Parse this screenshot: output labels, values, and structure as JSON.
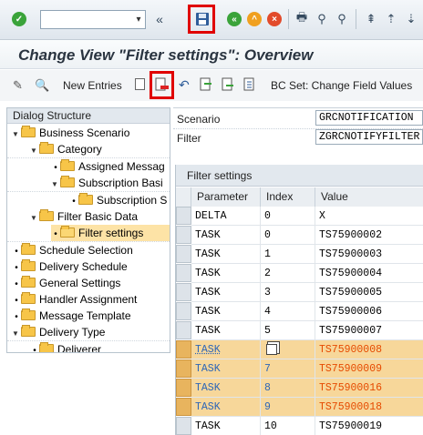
{
  "toolbar": {
    "command_value": "",
    "icons": [
      "enter-icon",
      "save-icon",
      "back-icon",
      "exit-icon",
      "cancel-icon",
      "print-icon",
      "find-icon",
      "find-next-icon",
      "first-page-icon",
      "prev-page-icon",
      "next-page-icon"
    ]
  },
  "title": "Change View \"Filter settings\": Overview",
  "app_toolbar": {
    "new_entries": "New Entries",
    "bc_set": "BC Set: Change Field Values"
  },
  "tree": {
    "header": "Dialog Structure",
    "items": [
      {
        "label": "Business Scenario"
      },
      {
        "label": "Category"
      },
      {
        "label": "Assigned Messag"
      },
      {
        "label": "Subscription Basi"
      },
      {
        "label": "Subscription S"
      },
      {
        "label": "Filter Basic Data"
      },
      {
        "label": "Filter settings"
      },
      {
        "label": "Schedule Selection"
      },
      {
        "label": "Delivery Schedule"
      },
      {
        "label": "General Settings"
      },
      {
        "label": "Handler Assignment"
      },
      {
        "label": "Message Template"
      },
      {
        "label": "Delivery Type"
      },
      {
        "label": "Deliverer"
      }
    ]
  },
  "fields": {
    "scenario_label": "Scenario",
    "scenario_value": "GRCNOTIFICATION",
    "filter_label": "Filter",
    "filter_value": "ZGRCNOTIFYFILTER"
  },
  "grid": {
    "title": "Filter settings",
    "columns": [
      "Parameter",
      "Index",
      "Value"
    ],
    "rows": [
      {
        "param": "DELTA",
        "index": "0",
        "value": "X",
        "highlighted": false
      },
      {
        "param": "TASK",
        "index": "0",
        "value": "TS75900002",
        "highlighted": false
      },
      {
        "param": "TASK",
        "index": "1",
        "value": "TS75900003",
        "highlighted": false
      },
      {
        "param": "TASK",
        "index": "2",
        "value": "TS75900004",
        "highlighted": false
      },
      {
        "param": "TASK",
        "index": "3",
        "value": "TS75900005",
        "highlighted": false
      },
      {
        "param": "TASK",
        "index": "4",
        "value": "TS75900006",
        "highlighted": false
      },
      {
        "param": "TASK",
        "index": "5",
        "value": "TS75900007",
        "highlighted": false
      },
      {
        "param": "TASK",
        "index": "",
        "value": "TS75900008",
        "highlighted": true
      },
      {
        "param": "TASK",
        "index": "7",
        "value": "TS75900009",
        "highlighted": true
      },
      {
        "param": "TASK",
        "index": "8",
        "value": "TS75900016",
        "highlighted": true
      },
      {
        "param": "TASK",
        "index": "9",
        "value": "TS75900018",
        "highlighted": true
      },
      {
        "param": "TASK",
        "index": "10",
        "value": "TS75900019",
        "highlighted": false
      }
    ]
  },
  "colors": {
    "highlight_row": "#f7d79a",
    "highlight_value": "#e64a00",
    "annotation_red": "#e00000",
    "folder": "#f7c548"
  }
}
